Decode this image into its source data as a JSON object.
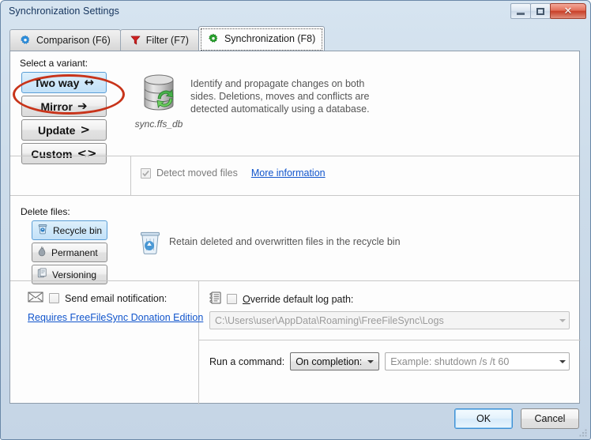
{
  "window": {
    "title": "Synchronization Settings",
    "buttons": {
      "minimize": "minimize-button",
      "maximize": "maximize-button",
      "close": "close-button"
    }
  },
  "tabs": [
    {
      "label": "Comparison (F6)",
      "icon": "gear-icon-blue",
      "active": false
    },
    {
      "label": "Filter (F7)",
      "icon": "funnel-icon-red",
      "active": false
    },
    {
      "label": "Synchronization (F8)",
      "icon": "gear-icon-green",
      "active": true
    }
  ],
  "variant": {
    "section_label": "Select a variant:",
    "options": [
      {
        "label": "Two way",
        "glyph": "↔",
        "selected": true
      },
      {
        "label": "Mirror",
        "glyph": "➔",
        "selected": false
      },
      {
        "label": "Update",
        "glyph": ">",
        "selected": false
      },
      {
        "label": "Custom",
        "glyph": "<>",
        "selected": false
      }
    ],
    "database_icon_caption": "sync.ffs_db",
    "description": "Identify and propagate changes on both sides. Deletions, moves and conflicts are detected automatically using a database.",
    "detect_moved_files": {
      "label": "Detect moved files",
      "checked": true,
      "enabled": false
    },
    "more_information_link": "More information"
  },
  "delete_files": {
    "section_label": "Delete files:",
    "options": [
      {
        "label": "Recycle bin",
        "icon": "recycle-bin-icon",
        "selected": true
      },
      {
        "label": "Permanent",
        "icon": "flame-icon",
        "selected": false
      },
      {
        "label": "Versioning",
        "icon": "versioning-icon",
        "selected": false
      }
    ],
    "description": "Retain deleted and overwritten files in the recycle bin"
  },
  "email": {
    "icon": "envelope-icon",
    "checkbox_label": "Send email notification:",
    "checked": false,
    "donation_link": "Requires FreeFileSync Donation Edition"
  },
  "log_path": {
    "icon": "log-file-icon",
    "checkbox_label": "Override default log path:",
    "checkbox_accelerator": "O",
    "checked": false,
    "value": "C:\\Users\\user\\AppData\\Roaming\\FreeFileSync\\Logs"
  },
  "run_command": {
    "label": "Run a command:",
    "trigger_selected": "On completion:",
    "command_placeholder": "Example: shutdown /s /t 60",
    "command_value": ""
  },
  "dialog_buttons": {
    "ok": "OK",
    "cancel": "Cancel"
  },
  "annotation": {
    "shape": "ellipse",
    "color": "#c8341a",
    "targets": "Two way"
  },
  "colors": {
    "accent_selection": "#cfe8fa",
    "link": "#1155cc",
    "annotation": "#c8341a",
    "title_text": "#14335c"
  }
}
